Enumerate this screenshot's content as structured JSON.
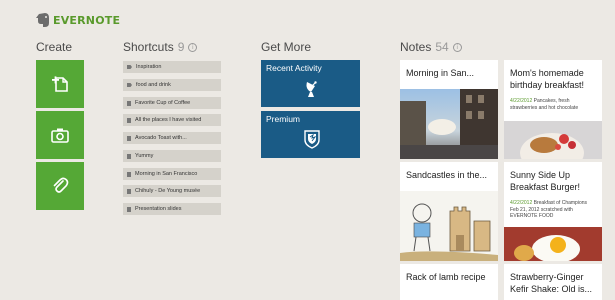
{
  "app": {
    "logo_text": "EVERNOTE"
  },
  "create": {
    "title": "Create",
    "tiles": [
      {
        "icon": "new-note-icon"
      },
      {
        "icon": "camera-icon"
      },
      {
        "icon": "paperclip-icon"
      }
    ]
  },
  "shortcuts": {
    "title": "Shortcuts",
    "count": "9",
    "items": [
      {
        "label": "Inspiration",
        "icon": "tag-icon"
      },
      {
        "label": "food and drink",
        "icon": "tag-icon"
      },
      {
        "label": "Favorite Cup of Coffee",
        "icon": "note-icon"
      },
      {
        "label": "All the places I have visited",
        "icon": "note-icon"
      },
      {
        "label": "Avocado Toast with...",
        "icon": "note-icon"
      },
      {
        "label": "Yummy",
        "icon": "note-icon"
      },
      {
        "label": "Morning in San Francisco",
        "icon": "note-icon"
      },
      {
        "label": "Chihuly - De Young musée",
        "icon": "note-icon"
      },
      {
        "label": "Presentation slides",
        "icon": "note-icon"
      }
    ]
  },
  "get_more": {
    "title": "Get More",
    "tiles": [
      {
        "label": "Recent Activity",
        "icon": "satellite-dish-icon"
      },
      {
        "label": "Premium",
        "icon": "shield-icon"
      }
    ]
  },
  "notes": {
    "title": "Notes",
    "count": "54",
    "items": [
      {
        "title": "Morning in San...",
        "date": "",
        "snippet": ""
      },
      {
        "title": "Mom's homemade birthday breakfast!",
        "date": "4/22/2012",
        "snippet": "Pancakes, fresh strawberries and hot chocolate"
      },
      {
        "title": "Sandcastles in the...",
        "date": "",
        "snippet": ""
      },
      {
        "title": "Sunny Side Up Breakfast Burger!",
        "date": "4/22/2012",
        "snippet": "Breakfast of Champions Feb 21, 2012 scratched with EVERNOTE FOOD"
      },
      {
        "title": "Rack of lamb recipe",
        "date": "",
        "snippet": ""
      },
      {
        "title": "Strawberry-Ginger Kefir Shake: Old is...",
        "date": "",
        "snippet": ""
      }
    ]
  },
  "colors": {
    "green": "#55a836",
    "blue": "#1a5b86",
    "background": "#ece9e4"
  }
}
